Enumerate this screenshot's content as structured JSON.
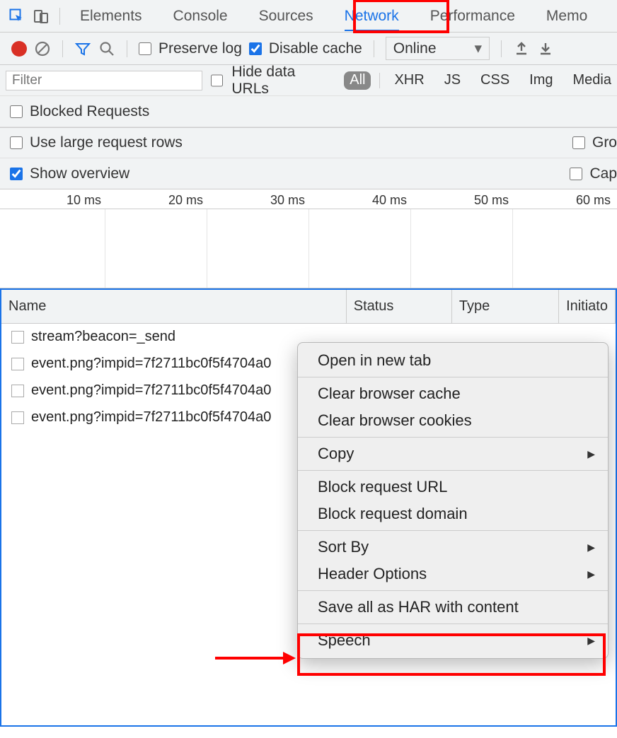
{
  "tabs": {
    "items": [
      "Elements",
      "Console",
      "Sources",
      "Network",
      "Performance",
      "Memo"
    ],
    "active_index": 3
  },
  "toolbar": {
    "preserve_log": "Preserve log",
    "preserve_log_checked": false,
    "disable_cache": "Disable cache",
    "disable_cache_checked": true,
    "throttling": "Online"
  },
  "filters": {
    "placeholder": "Filter",
    "hide_data_urls": "Hide data URLs",
    "hide_data_urls_checked": false,
    "pills": [
      "All",
      "XHR",
      "JS",
      "CSS",
      "Img",
      "Media"
    ],
    "active_pill": 0
  },
  "options": {
    "blocked_requests": "Blocked Requests",
    "blocked_checked": false,
    "large_rows": "Use large request rows",
    "large_rows_checked": false,
    "gro": "Gro",
    "gro_checked": false,
    "overview": "Show overview",
    "overview_checked": true,
    "cap": "Cap",
    "cap_checked": false
  },
  "timeline": {
    "ticks": [
      "10 ms",
      "20 ms",
      "30 ms",
      "40 ms",
      "50 ms",
      "60 ms"
    ]
  },
  "table": {
    "headers": {
      "name": "Name",
      "status": "Status",
      "type": "Type",
      "initiator": "Initiato"
    },
    "rows": [
      "stream?beacon=_send",
      "event.png?impid=7f2711bc0f5f4704a0",
      "event.png?impid=7f2711bc0f5f4704a0",
      "event.png?impid=7f2711bc0f5f4704a0"
    ]
  },
  "context_menu": {
    "items": [
      {
        "label": "Open in new tab",
        "arrow": false
      },
      {
        "sep": true
      },
      {
        "label": "Clear browser cache",
        "arrow": false
      },
      {
        "label": "Clear browser cookies",
        "arrow": false
      },
      {
        "sep": true
      },
      {
        "label": "Copy",
        "arrow": true
      },
      {
        "sep": true
      },
      {
        "label": "Block request URL",
        "arrow": false
      },
      {
        "label": "Block request domain",
        "arrow": false
      },
      {
        "sep": true
      },
      {
        "label": "Sort By",
        "arrow": true
      },
      {
        "label": "Header Options",
        "arrow": true
      },
      {
        "sep": true
      },
      {
        "label": "Save all as HAR with content",
        "arrow": false
      },
      {
        "sep": true
      },
      {
        "label": "Speech",
        "arrow": true
      }
    ]
  }
}
